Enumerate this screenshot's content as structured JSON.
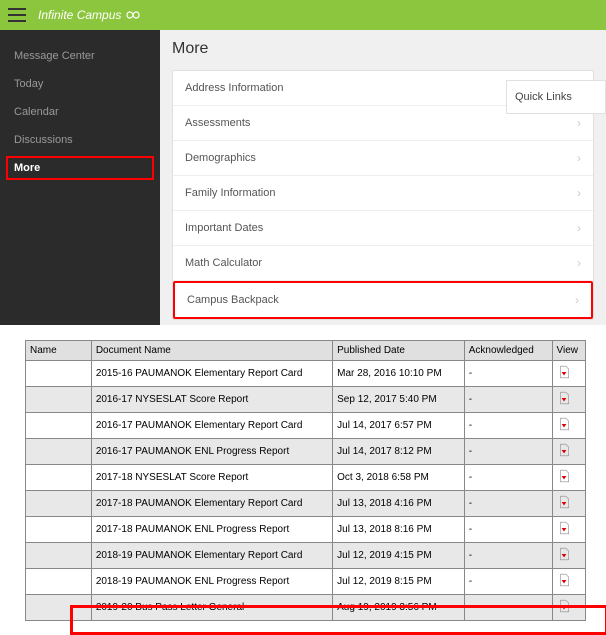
{
  "header": {
    "brand": "Infinite Campus"
  },
  "sidebar": {
    "items": [
      {
        "label": "Message Center"
      },
      {
        "label": "Today"
      },
      {
        "label": "Calendar"
      },
      {
        "label": "Discussions"
      },
      {
        "label": "More"
      }
    ]
  },
  "page": {
    "title": "More"
  },
  "more_list": [
    {
      "label": "Address Information"
    },
    {
      "label": "Assessments"
    },
    {
      "label": "Demographics"
    },
    {
      "label": "Family Information"
    },
    {
      "label": "Important Dates"
    },
    {
      "label": "Math Calculator"
    },
    {
      "label": "Campus Backpack"
    }
  ],
  "quick_links": {
    "title": "Quick Links"
  },
  "table": {
    "headers": {
      "name": "Name",
      "document": "Document Name",
      "published": "Published Date",
      "acknowledged": "Acknowledged",
      "view": "View"
    },
    "rows": [
      {
        "name": "",
        "doc": "2015-16 PAUMANOK Elementary Report Card",
        "pub": "Mar 28, 2016 10:10 PM",
        "ack": "-"
      },
      {
        "name": "",
        "doc": "2016-17 NYSESLAT Score Report",
        "pub": "Sep 12, 2017 5:40 PM",
        "ack": "-"
      },
      {
        "name": "",
        "doc": "2016-17 PAUMANOK Elementary Report Card",
        "pub": "Jul 14, 2017 6:57 PM",
        "ack": "-"
      },
      {
        "name": "",
        "doc": "2016-17 PAUMANOK ENL Progress Report",
        "pub": "Jul 14, 2017 8:12 PM",
        "ack": "-"
      },
      {
        "name": "",
        "doc": "2017-18 NYSESLAT Score Report",
        "pub": "Oct 3, 2018 6:58 PM",
        "ack": "-"
      },
      {
        "name": "",
        "doc": "2017-18 PAUMANOK Elementary Report Card",
        "pub": "Jul 13, 2018 4:16 PM",
        "ack": "-"
      },
      {
        "name": "",
        "doc": "2017-18 PAUMANOK ENL Progress Report",
        "pub": "Jul 13, 2018 8:16 PM",
        "ack": "-"
      },
      {
        "name": "",
        "doc": "2018-19 PAUMANOK Elementary Report Card",
        "pub": "Jul 12, 2019 4:15 PM",
        "ack": "-"
      },
      {
        "name": "",
        "doc": "2018-19 PAUMANOK ENL Progress Report",
        "pub": "Jul 12, 2019 8:15 PM",
        "ack": "-"
      },
      {
        "name": "",
        "doc": "2019-20 Bus Pass Letter General",
        "pub": "Aug 19, 2019 3:56 PM",
        "ack": "-"
      }
    ]
  }
}
